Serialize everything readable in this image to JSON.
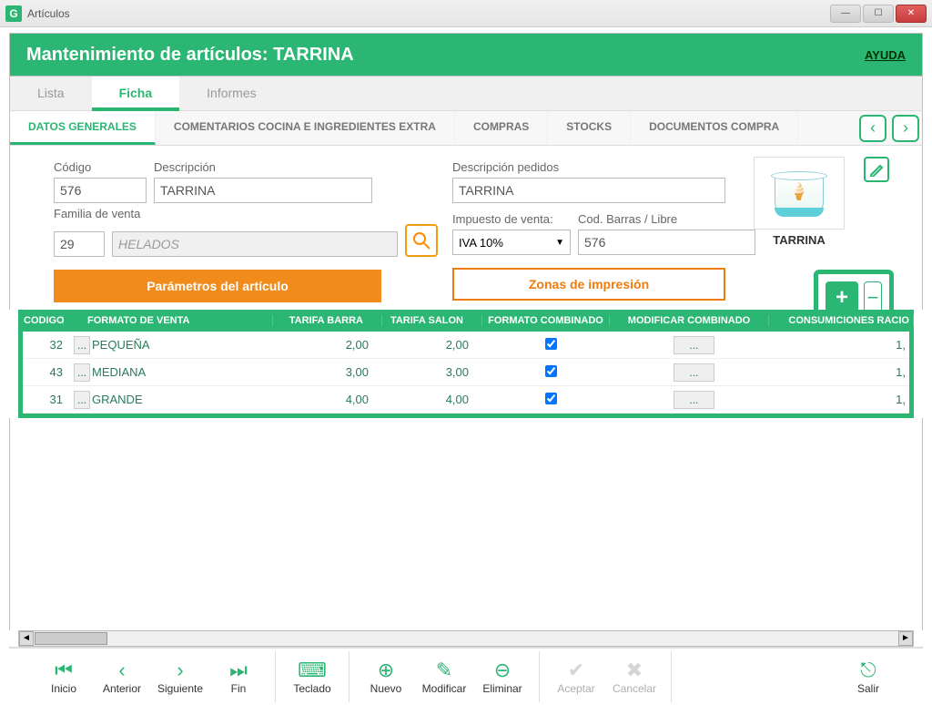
{
  "window": {
    "title": "Artículos",
    "icon": "G"
  },
  "band": {
    "title": "Mantenimiento de artículos: TARRINA",
    "help": "AYUDA"
  },
  "tabs": [
    {
      "label": "Lista",
      "active": false
    },
    {
      "label": "Ficha",
      "active": true
    },
    {
      "label": "Informes",
      "active": false
    }
  ],
  "subtabs": {
    "items": [
      {
        "label": "DATOS GENERALES",
        "active": true
      },
      {
        "label": "COMENTARIOS COCINA E INGREDIENTES EXTRA"
      },
      {
        "label": "COMPRAS"
      },
      {
        "label": "STOCKS"
      },
      {
        "label": "DOCUMENTOS COMPRA"
      }
    ]
  },
  "form": {
    "codigo_label": "Código",
    "codigo": "576",
    "descripcion_label": "Descripción",
    "descripcion": "TARRINA",
    "descpedidos_label": "Descripción pedidos",
    "descpedidos": "TARRINA",
    "familia_label": "Familia de venta",
    "familia_code": "29",
    "familia_name": "HELADOS",
    "impuesto_label": "Impuesto de venta:",
    "impuesto": "IVA 10%",
    "codbarras_label": "Cod. Barras / Libre",
    "codbarras": "576",
    "btn_parametros": "Parámetros del artículo",
    "btn_zonas": "Zonas de impresión",
    "product_label": "TARRINA"
  },
  "table": {
    "headers": {
      "codigo": "CODIGO",
      "formato": "FORMATO DE VENTA",
      "tbarra": "TARIFA BARRA",
      "tsalon": "TARIFA SALON",
      "fcomb": "FORMATO COMBINADO",
      "mcomb": "MODIFICAR COMBINADO",
      "cons": "CONSUMICIONES RACIO"
    },
    "rows": [
      {
        "codigo": "32",
        "formato": "PEQUEÑA",
        "tbarra": "2,00",
        "tsalon": "2,00",
        "comb": true,
        "cons": "1,"
      },
      {
        "codigo": "43",
        "formato": "MEDIANA",
        "tbarra": "3,00",
        "tsalon": "3,00",
        "comb": true,
        "cons": "1,"
      },
      {
        "codigo": "31",
        "formato": "GRANDE",
        "tbarra": "4,00",
        "tsalon": "4,00",
        "comb": true,
        "cons": "1,"
      }
    ],
    "mod_button": "..."
  },
  "toolbar": {
    "inicio": "Inicio",
    "anterior": "Anterior",
    "siguiente": "Siguiente",
    "fin": "Fin",
    "teclado": "Teclado",
    "nuevo": "Nuevo",
    "modificar": "Modificar",
    "eliminar": "Eliminar",
    "aceptar": "Aceptar",
    "cancelar": "Cancelar",
    "salir": "Salir"
  }
}
